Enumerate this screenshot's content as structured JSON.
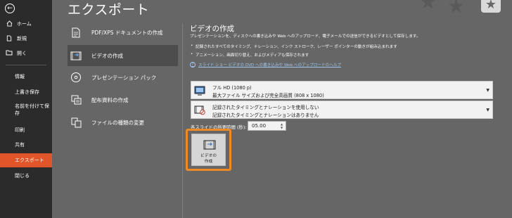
{
  "nav": {
    "back_glyph": "←",
    "items": [
      {
        "label": "ホーム",
        "icon": "home-icon"
      },
      {
        "label": "新規",
        "icon": "new-document-icon"
      },
      {
        "label": "開く",
        "icon": "folder-open-icon"
      },
      {
        "label": "情報"
      },
      {
        "label": "上書き保存"
      },
      {
        "label": "名前を付けて保存"
      },
      {
        "label": "印刷"
      },
      {
        "label": "共有"
      },
      {
        "label": "エクスポート"
      },
      {
        "label": "閉じる"
      }
    ],
    "active_index": 8,
    "active_color": "#e0552a"
  },
  "page_title": "エクスポート",
  "export_options": [
    {
      "label": "PDF/XPS ドキュメントの作成",
      "icon": "pdf-document-icon"
    },
    {
      "label": "ビデオの作成",
      "icon": "video-film-icon"
    },
    {
      "label": "プレゼンテーション パック",
      "icon": "disc-package-icon"
    },
    {
      "label": "配布資料の作成",
      "icon": "handout-icon"
    },
    {
      "label": "ファイルの種類の変更",
      "icon": "file-type-change-icon"
    }
  ],
  "selected_option_index": 1,
  "panel": {
    "title": "ビデオの作成",
    "description": "プレゼンテーションを、ディスクへの書き込みや Web へのアップロード、電子メールでの送信ができるビデオとして保存します。",
    "bullets": [
      "記録されたすべてのタイミング、ナレーション、インク ストローク、レーザー ポインターの動きが組み込まれます",
      "アニメーション、画面切り替え、およびメディアも保存されます"
    ],
    "help_link": "スライド ショー ビデオの DVD への書き込みや Web へのアップロードのヘルプ",
    "quality_dropdown": {
      "line1": "フル HD (1080 p)",
      "line2": "最大ファイル サイズおよび完全高画質 (808 x 1080)",
      "icon": "monitor-icon"
    },
    "timing_dropdown": {
      "line1": "記録されたタイミングとナレーションを使用しない",
      "line2": "記録されたタイミングとナレーションはありません",
      "icon": "no-recording-icon"
    },
    "duration_label": "各スライドの所要時間 (秒):",
    "duration_value": "05.00",
    "create_button": {
      "line1": "ビデオの",
      "line2": "作成",
      "highlight_color": "#f08a24"
    }
  }
}
